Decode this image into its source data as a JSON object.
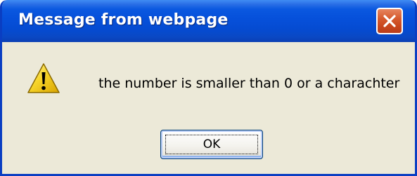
{
  "window": {
    "title": "Message from webpage"
  },
  "dialog": {
    "icon": "warning-icon",
    "message": "the number is smaller than 0 or a charachter",
    "ok_label": "OK"
  },
  "colors": {
    "titlebar": "#0650da",
    "dialog_background": "#ece9d8",
    "close_button": "#d65a2e",
    "warning_yellow": "#f7d52a"
  }
}
